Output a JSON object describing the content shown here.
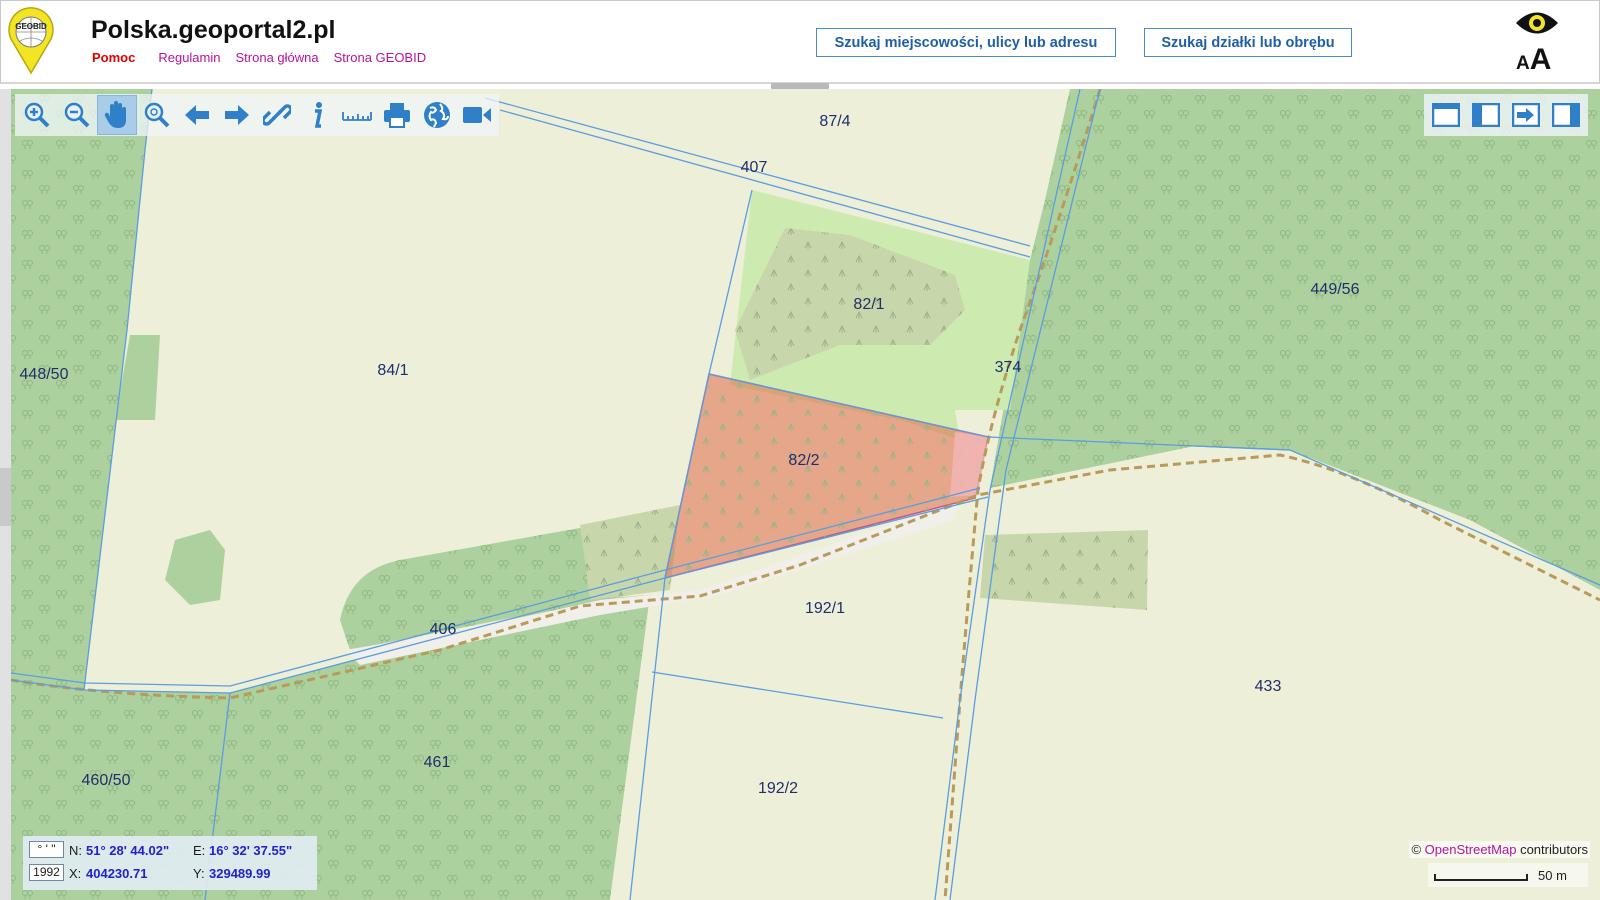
{
  "header": {
    "logo_text": "GEOBID",
    "title": "Polska.geoportal2.pl",
    "nav": {
      "help": "Pomoc",
      "rules": "Regulamin",
      "home": "Strona główna",
      "geobid": "Strona GEOBID"
    },
    "search_address_label": "Szukaj miejscowości, ulicy lub adresu",
    "search_parcel_label": "Szukaj działki lub obrębu",
    "accessibility_font_label_small": "A",
    "accessibility_font_label_large": "A"
  },
  "toolbar": {
    "tools": [
      "zoom-in-icon",
      "zoom-out-icon",
      "pan-hand-icon",
      "zoom-extent-icon",
      "back-arrow-icon",
      "forward-arrow-icon",
      "link-icon",
      "info-icon",
      "measure-ruler-icon",
      "print-icon",
      "globe-icon",
      "video-camera-icon"
    ],
    "active_tool": "pan-hand-icon",
    "right_tools": [
      "full-window-icon",
      "sidebar-left-icon",
      "export-arrow-icon",
      "sidebar-right-icon"
    ]
  },
  "map": {
    "parcel_labels": {
      "p87_4": "87/4",
      "p407": "407",
      "p82_1": "82/1",
      "p449_56": "449/56",
      "p448_50": "448/50",
      "p84_1": "84/1",
      "p374": "374",
      "p82_2": "82/2",
      "p192_1": "192/1",
      "p406": "406",
      "p433": "433",
      "p461": "461",
      "p460_50": "460/50",
      "p192_2": "192/2"
    },
    "selected_parcel": "82/2",
    "colors": {
      "farmland": "#eeefd8",
      "forest": "#add19e",
      "meadow": "#cdebb0",
      "scrub": "#c8d7ab",
      "parcel_border": "#5a9de0",
      "selection_fill": "#e06a4a",
      "track": "#b89a5a"
    }
  },
  "coords": {
    "format_toggle": "° ' \"",
    "system_toggle": "1992",
    "n_label": "N:",
    "n_value": "51° 28' 44.02\"",
    "e_label": "E:",
    "e_value": "16° 32' 37.55\"",
    "x_label": "X:",
    "x_value": "404230.71",
    "y_label": "Y:",
    "y_value": "329489.99"
  },
  "attribution": {
    "prefix": "©",
    "link": "OpenStreetMap",
    "suffix": "contributors"
  },
  "scale": {
    "label": "50 m"
  }
}
